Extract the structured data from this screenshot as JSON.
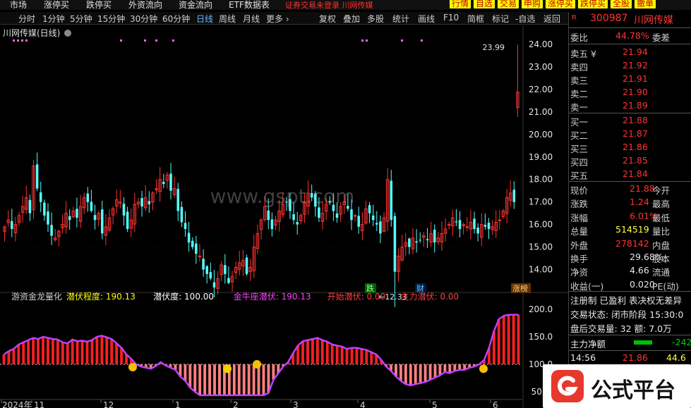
{
  "topnav": {
    "items": [
      "市场",
      "涨停买",
      "跌停买",
      "外资流向",
      "资金流向",
      "ETF数据表"
    ],
    "login_text": "证券交易未登录  川网传媒",
    "buttons": [
      "行情",
      "自选",
      "交易",
      "申购",
      "涨停买",
      "跌停买",
      "全股",
      "撤单"
    ]
  },
  "period_tabs": [
    "分时",
    "1分钟",
    "5分钟",
    "15分钟",
    "30分钟",
    "60分钟",
    "日线",
    "周线",
    "月线",
    "更多 ›"
  ],
  "active_tab": "日线",
  "toolbar": [
    "复权",
    "叠加",
    "多股",
    "统计",
    "画线",
    "F10",
    "简框",
    "标记",
    "-自选",
    "返回"
  ],
  "chart_title": "川网传媒(日线)",
  "chart_data": [
    {
      "type": "candlestick",
      "title": "川网传媒(日线)",
      "y_ticks": [
        24.0,
        23.0,
        22.0,
        21.0,
        20.0,
        19.0,
        18.0,
        17.0,
        16.0,
        15.0,
        14.0
      ],
      "ylim": [
        13.2,
        24.6
      ],
      "annotations": {
        "high": "23.99",
        "low": "←12.33"
      },
      "x_labels": [
        "2024年",
        "11",
        "12",
        "1",
        "2",
        "3",
        "4",
        "5",
        "6"
      ],
      "markers": [
        "跌",
        "财",
        "涨榜"
      ],
      "candles_approx_close": [
        15.9,
        16.2,
        15.8,
        16.0,
        16.4,
        16.8,
        17.2,
        16.5,
        18.6,
        17.6,
        17.0,
        16.4,
        16.0,
        15.5,
        15.4,
        15.7,
        16.0,
        16.5,
        16.2,
        16.6,
        16.3,
        16.8,
        17.2,
        17.0,
        16.6,
        16.2,
        16.5,
        15.6,
        15.9,
        16.3,
        16.7,
        17.1,
        17.0,
        16.4,
        15.8,
        16.2,
        16.9,
        17.0,
        16.8,
        17.2,
        16.9,
        17.4,
        17.6,
        18.0,
        17.8,
        18.2,
        17.5,
        17.6,
        16.6,
        16.1,
        15.8,
        15.2,
        15.0,
        14.7,
        14.6,
        14.0,
        13.8,
        13.6,
        13.2,
        13.6,
        14.2,
        13.8,
        13.4,
        13.7,
        14.1,
        14.3,
        14.4,
        13.8,
        14.1,
        15.0,
        15.6,
        16.2,
        16.8,
        16.2,
        15.8,
        16.2,
        16.6,
        16.9,
        17.0,
        16.6,
        16.2,
        16.0,
        16.4,
        17.0,
        17.4,
        17.2,
        16.8,
        16.3,
        16.5,
        16.9,
        17.0,
        16.6,
        16.3,
        16.8,
        17.0,
        16.7,
        16.2,
        16.4,
        15.9,
        16.0,
        16.7,
        16.5,
        16.2,
        16.0,
        15.6,
        16.3,
        18.0,
        16.2,
        13.9,
        14.6,
        15.0,
        15.2,
        15.0,
        15.4,
        15.2,
        15.3,
        15.5,
        15.3,
        15.6,
        15.2,
        15.4,
        15.6,
        15.8,
        16.0,
        16.3,
        16.1,
        15.8,
        16.0,
        15.9,
        16.1,
        15.8,
        15.6,
        16.0,
        15.9,
        15.8,
        15.9,
        16.1,
        16.2,
        16.6,
        17.2,
        17.4,
        17.0,
        21.88
      ]
    },
    {
      "type": "area",
      "title": "游资金龙量化",
      "y_ticks": [
        200.0,
        150.0,
        100.0,
        50.0
      ],
      "legend": [
        {
          "name": "潜伏程度",
          "value": "190.13",
          "color": "#ffff00"
        },
        {
          "name": "潜伏度",
          "value": "100.00",
          "color": "#ffffff"
        },
        {
          "name": "金牛座潜伏",
          "value": "190.13",
          "color": "#ff40ff"
        },
        {
          "name": "开始潜伏",
          "value": "0.00",
          "color": "#ff4040"
        },
        {
          "name": "主力潜伏",
          "value": "0.00",
          "color": "#ff4040"
        }
      ],
      "values": [
        118,
        124,
        128,
        136,
        140,
        144,
        148,
        146,
        150,
        148,
        146,
        145,
        140,
        138,
        145,
        142,
        143,
        141,
        144,
        150,
        152,
        149,
        146,
        138,
        130,
        118,
        110,
        100,
        96,
        94,
        92,
        97,
        104,
        98,
        94,
        90,
        78,
        70,
        58,
        50,
        44,
        44,
        44,
        44,
        44,
        44,
        44,
        44,
        44,
        44,
        44,
        44,
        44,
        44,
        48,
        72,
        84,
        96,
        104,
        120,
        134,
        142,
        144,
        146,
        148,
        144,
        141,
        136,
        134,
        132,
        128,
        130,
        130,
        128,
        126,
        122,
        118,
        108,
        96,
        88,
        78,
        70,
        64,
        62,
        64,
        66,
        68,
        72,
        76,
        80,
        86,
        84,
        88,
        90,
        90,
        94,
        96,
        100,
        108,
        130,
        160,
        182,
        188,
        190,
        190,
        190
      ]
    }
  ],
  "stock": {
    "code": "300987",
    "name": "川网传媒"
  },
  "quote": {
    "weibi_label": "委比",
    "weibi": "44.78%",
    "weicha_label": "委差",
    "asks": [
      {
        "label": "卖五 ¥",
        "price": "21.94"
      },
      {
        "label": "卖四",
        "price": "21.92"
      },
      {
        "label": "卖三",
        "price": "21.91"
      },
      {
        "label": "卖二",
        "price": "21.90"
      },
      {
        "label": "卖一",
        "price": "21.89"
      }
    ],
    "bids": [
      {
        "label": "买一",
        "price": "21.88"
      },
      {
        "label": "买二",
        "price": "21.87"
      },
      {
        "label": "买三",
        "price": "21.86"
      },
      {
        "label": "买四",
        "price": "21.85"
      },
      {
        "label": "买五",
        "price": "21.84"
      }
    ],
    "stats": [
      {
        "label": "现价",
        "value": "21.88",
        "label2": "今开"
      },
      {
        "label": "涨跌",
        "value": "1.24",
        "label2": "最高"
      },
      {
        "label": "涨幅",
        "value": "6.01%",
        "label2": "最低"
      },
      {
        "label": "总量",
        "value": "514519",
        "label2": "量比"
      },
      {
        "label": "外盘",
        "value": "278142",
        "label2": "内盘"
      },
      {
        "label": "换手",
        "value": "29.68%",
        "label2": "股本"
      },
      {
        "label": "净资",
        "value": "4.66",
        "label2": "流通"
      },
      {
        "label": "收益(一)",
        "value": "0.020",
        "label2": "PE(动)"
      }
    ],
    "info_line1": "注册制  已盈利  表决权无差异",
    "info_line2": "交易状态: 闭市阶段 15:30:0",
    "info_line3": "盘后交易量: 32  额: 7.0万",
    "main_net_label": "主力净额",
    "main_net_value": "-242",
    "tick_time": "14:56",
    "tick_price": "21.86",
    "tick_vol": "44.6"
  },
  "watermark": "www.gspt.com",
  "logo_text": "公式平台",
  "colors": {
    "up": "#ff3232",
    "down": "#54ffff",
    "bg": "#000000"
  }
}
